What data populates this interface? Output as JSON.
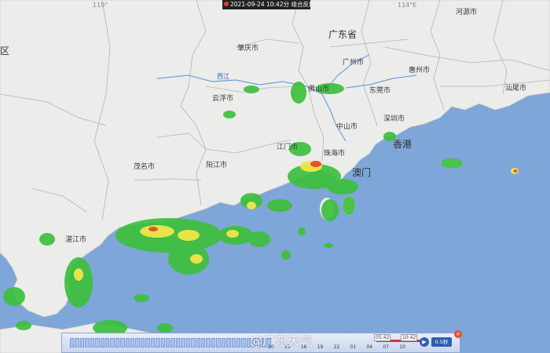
{
  "header": {
    "timestamp": "2021-09-24 10:42分",
    "product": "组合反射率"
  },
  "map": {
    "province_label": "广东省",
    "region_left": "区",
    "river_label": "西江",
    "grid_labels": [
      "110°",
      "114°E"
    ],
    "cities": [
      {
        "name": "肇庆市"
      },
      {
        "name": "广州市"
      },
      {
        "name": "河源市"
      },
      {
        "name": "惠州市"
      },
      {
        "name": "佛山市"
      },
      {
        "name": "东莞市"
      },
      {
        "name": "汕尾市"
      },
      {
        "name": "云浮市"
      },
      {
        "name": "中山市"
      },
      {
        "name": "深圳市"
      },
      {
        "name": "江门市"
      },
      {
        "name": "珠海市"
      },
      {
        "name": "香港"
      },
      {
        "name": "澳门"
      },
      {
        "name": "茂名市"
      },
      {
        "name": "阳江市"
      },
      {
        "name": "湛江市"
      }
    ]
  },
  "timeline": {
    "ticks": [
      "10",
      "13",
      "16",
      "19",
      "22",
      "01",
      "04",
      "07",
      "10"
    ],
    "start": "05:42",
    "end": "10:42",
    "speed_label": "0.5秒",
    "play_icon": "play-icon",
    "close_icon": "close-icon"
  },
  "watermark": "@广东天气",
  "colors": {
    "sea": "#7ea6d8",
    "land": "#ececea",
    "border": "#b9b9b9",
    "echo_low": "#3cc03c",
    "echo_mid": "#f0e64a",
    "echo_high": "#e2522d"
  }
}
